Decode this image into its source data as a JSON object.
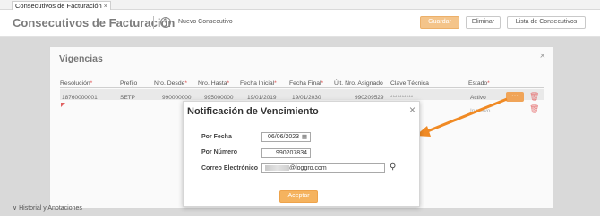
{
  "tab": {
    "label": "Consecutivos de Facturación",
    "close": "×"
  },
  "header": {
    "title": "Consecutivos de Facturación",
    "add_icon": "+",
    "new_label": "Nuevo Consecutivo",
    "buttons": {
      "save": "Guardar",
      "delete": "Eliminar",
      "list": "Lista de Consecutivos"
    }
  },
  "vigencias": {
    "title": "Vigencias",
    "close": "×",
    "columns": [
      "Resolución",
      "Prefijo",
      "Nro. Desde",
      "Nro. Hasta",
      "Fecha Inicial",
      "Fecha Final",
      "Últ. Nro. Asignado",
      "Clave Técnica",
      "Estado"
    ],
    "required_mark": "*",
    "row": {
      "resolucion": "18760000001",
      "prefijo": "SETP",
      "desde": "990000000",
      "hasta": "995000000",
      "fecha_inicial": "19/01/2019",
      "fecha_final": "19/01/2030",
      "ultimo": "990209529",
      "clave": "**********",
      "estado": "Activo"
    },
    "row2_estado": "Inactivo",
    "more": "…",
    "trash_icon": "🗑"
  },
  "history": {
    "label": "Historial y Anotaciones",
    "chevron": "∨"
  },
  "modal": {
    "title": "Notificación de Vencimiento",
    "close": "×",
    "label_fecha": "Por Fecha",
    "value_fecha": "06/06/2023",
    "label_numero": "Por Número",
    "value_numero": "990207834",
    "label_email": "Correo Electrónico",
    "value_email": "@loggro.com",
    "accept": "Aceptar"
  },
  "colors": {
    "accent": "#f5b35f",
    "arrow": "#f08a24"
  }
}
